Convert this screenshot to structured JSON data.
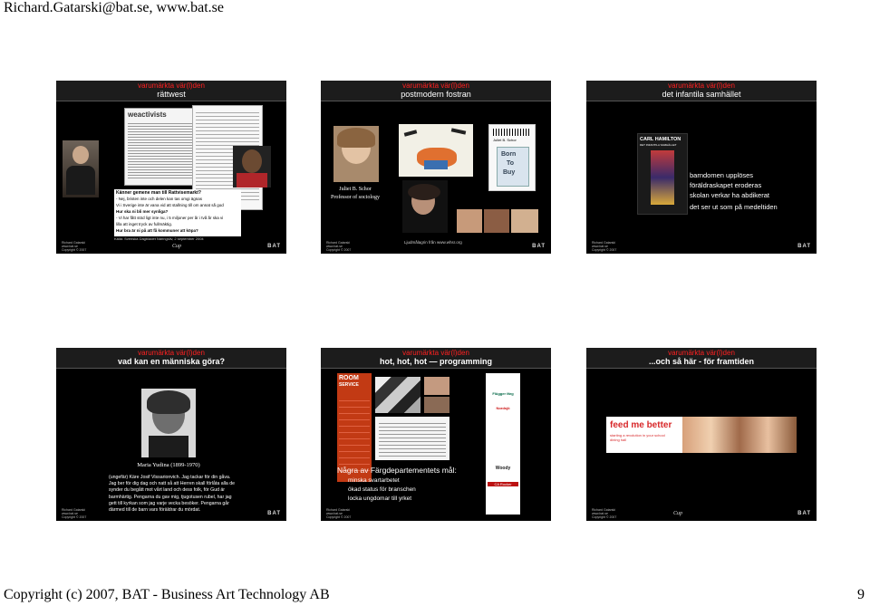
{
  "header": "Richard.Gatarski@bat.se, www.bat.se",
  "footer": "Copyright (c) 2007, BAT - Business Art Technology AB",
  "page_number": "9",
  "slide_common": {
    "tag": "varumärkta vär(l)den",
    "footer_left": "Richard Gatarski\nwww.bat.se\nCopyright © 2007",
    "footer_right": "BAT",
    "footer_mid": "Cup"
  },
  "slides": [
    {
      "title": "rättwest",
      "weactivists_logo": "weactivists",
      "question_heading": "Känner gemene man till Rattvisemarkt?",
      "question_lines": [
        "- Nej, bristen inte och delen kan tas omgi ägnas",
        "Vi i Sverige inte är vana vid att stallning till om annat så god",
        "Hur ska ni bli mer synliga?",
        "- Vi har fått stöd ligt inte nu, i 5 miljoner per år i två år ska vi",
        "lilla att inget tryck av fullmäktig.",
        "Hur bra är ni på att få kommuner att köpa?"
      ],
      "source": "Källa: Svenska Dagbladet Näringsliv, 2 september 2004"
    },
    {
      "title": "postmodern fostran",
      "caption_name": "Juliet B. Schor",
      "caption_role": "Professor of sociology",
      "book_author": "Juliet B. Schor",
      "book_title_1": "Born",
      "book_title_2": "To",
      "book_title_3": "Buy",
      "image_credit": "Ljudmålagrin från www.whsr.org"
    },
    {
      "title": "det infantila samhället",
      "book_author": "CARL HAMILTON",
      "book_subtitle": "DET INFANTILA SAMHÄLLET",
      "body_lines": [
        "barndomen upplöses",
        "föräldraskapet eroderas",
        "skolan verkar ha abdikerat",
        "det ser ut som på medeltiden"
      ]
    },
    {
      "title": "vad kan en människa göra?",
      "caption": "Maria Yudina (1899-1970)",
      "body": "(ungefär) Käre Josif Vissarionvich. Jag tackar för din gåva. Jag ber för dig dag och natt så att Herren skall förlåta alla de synder du begått mot vårt land och dess folk, för Gud är barmhärtig. Pengarna du gav mig, tjugotusen rubel, har jag gett till kyrkan som jag varje vecka besöker. Pengarna går därmed till de barn vars föräldrar du mördat."
    },
    {
      "title": "hot, hot, hot — programming",
      "room_service_line_1": "ROOM",
      "room_service_line_2": "SERVICE",
      "body_heading": "Några av Färgdepartementets mål:",
      "body_lines": [
        "minska svartarbetet",
        "ökad status för branschen",
        "locka ungdomar till yrket"
      ],
      "sponsor_labels": [
        "Flügger färg",
        "Nordsjö",
        "Woody",
        "CA Rocker"
      ]
    },
    {
      "title": "...och så här - för framtiden",
      "banner_text": "feed me better",
      "banner_sub": "starting a revolution in your school dining hall"
    }
  ],
  "colors": {
    "slide_bg": "#000000",
    "tag_red": "#ff2020",
    "banner_red": "#d8282a"
  }
}
